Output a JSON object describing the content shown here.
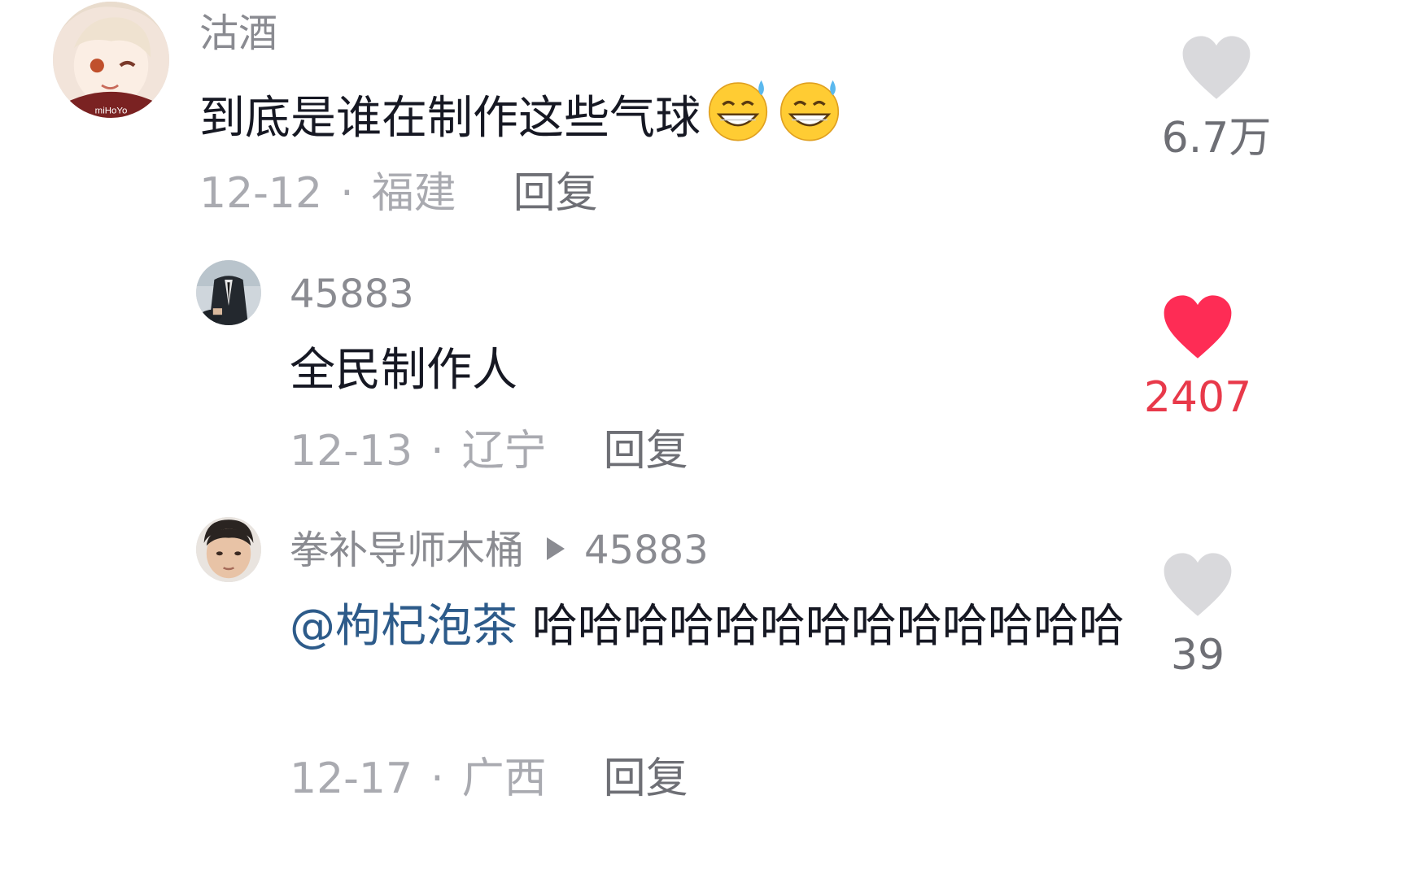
{
  "comments": [
    {
      "username": "沽酒",
      "text": "到底是谁在制作这些气球",
      "emoji": "sweat-grin-emoji",
      "date": "12-12",
      "location": "福建",
      "reply_label": "回复",
      "like_count": "6.7万",
      "liked": false
    },
    {
      "username": "45883",
      "text": "全民制作人",
      "date": "12-13",
      "location": "辽宁",
      "reply_label": "回复",
      "like_count": "2407",
      "liked": true
    },
    {
      "username": "拳补导师木桶",
      "reply_to": "45883",
      "mention": "@枸杞泡茶",
      "text": "哈哈哈哈哈哈哈哈哈哈哈哈哈",
      "date": "12-17",
      "location": "广西",
      "reply_label": "回复",
      "like_count": "39",
      "liked": false
    }
  ],
  "separator": "·",
  "colors": {
    "liked_heart": "#fe2c55",
    "unliked_heart": "#d9d9dc",
    "mention": "#2d5b8a",
    "secondary_text": "#a9aab0"
  }
}
